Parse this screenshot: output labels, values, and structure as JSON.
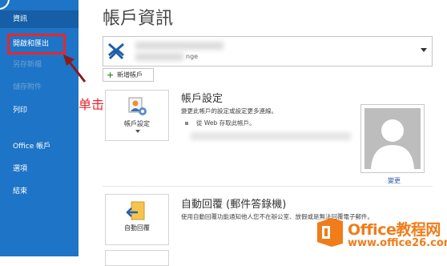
{
  "sidebar": {
    "items": [
      {
        "label": "資訊",
        "state": "active"
      },
      {
        "label": "開啟和匯出",
        "state": "highlighted"
      },
      {
        "label": "另存新檔",
        "state": "disabled"
      },
      {
        "label": "儲存附件",
        "state": "disabled"
      },
      {
        "label": "列印",
        "state": "normal"
      },
      {
        "label": "Office 帳戶",
        "state": "normal"
      },
      {
        "label": "選項",
        "state": "normal"
      },
      {
        "label": "結束",
        "state": "normal"
      }
    ]
  },
  "annotation": {
    "text": "单击"
  },
  "main": {
    "title": "帳戶資訊",
    "account": {
      "domain_fragment": "nge"
    },
    "add_account_label": "新增帳戶",
    "account_settings": {
      "tile_label": "帳戶設定",
      "title": "帳戶設定",
      "description": "變更此帳戶的設定或設定更多連線。",
      "bullet": "從 Web 存取此帳戶。"
    },
    "profile": {
      "change_label": "變更"
    },
    "auto_reply": {
      "tile_label": "自動回覆",
      "title": "自動回覆 (郵件答錄機)",
      "description": "使用自動回覆功能通知他人您不在辦公室、放假或是無法回覆電子郵件。"
    }
  },
  "watermark": {
    "line1": "Office教程网",
    "line2": "www.office26.com"
  },
  "colors": {
    "sidebar": "#1e74c6",
    "highlight": "#e8262e",
    "watermark": "#f07c1a"
  }
}
